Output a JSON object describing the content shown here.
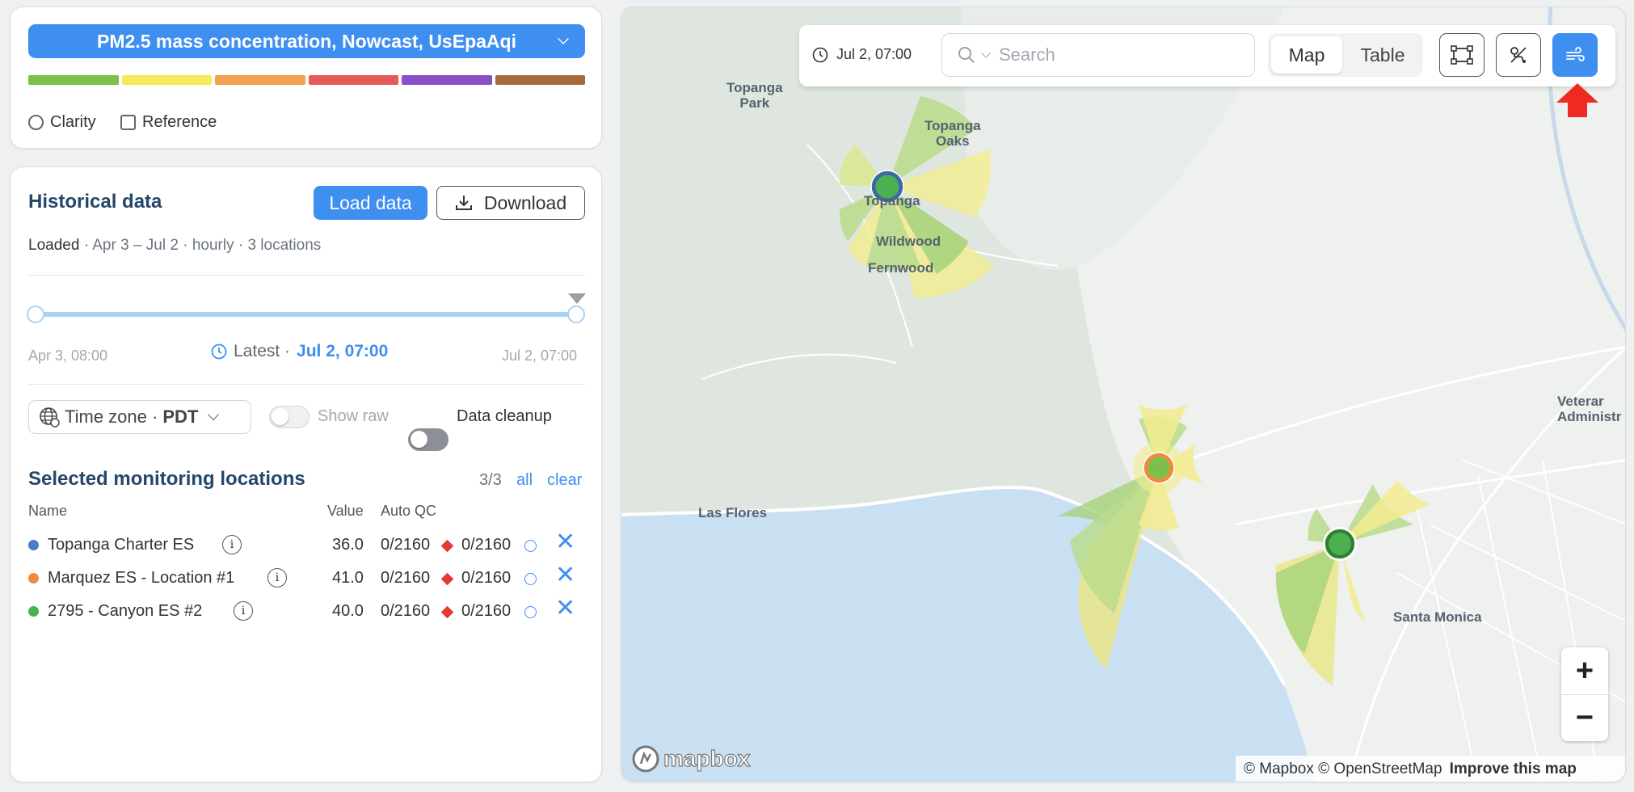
{
  "pollutant": {
    "label": "PM2.5 mass concentration, Nowcast, UsEpaAqi"
  },
  "aqi_colors": [
    "#7cc04c",
    "#f6e85a",
    "#f0a44c",
    "#e85a55",
    "#8a4fc7",
    "#a86b40"
  ],
  "sources": {
    "clarity": "Clarity",
    "reference": "Reference"
  },
  "historical": {
    "title": "Historical data",
    "load_label": "Load data",
    "download_label": "Download",
    "status": "Loaded",
    "range": "Apr 3 – Jul 2",
    "interval": "hourly",
    "locations_count": "3 locations",
    "slider_start": "Apr 3, 08:00",
    "slider_end": "Jul 2, 07:00",
    "latest_label": "Latest ·",
    "latest_value": "Jul 2, 07:00"
  },
  "controls": {
    "timezone_label": "Time zone ·",
    "timezone_value": "PDT",
    "show_raw": "Show raw",
    "data_cleanup": "Data cleanup"
  },
  "selected": {
    "title": "Selected monitoring locations",
    "count": "3/3",
    "all": "all",
    "clear": "clear",
    "columns": {
      "name": "Name",
      "value": "Value",
      "auto_qc": "Auto QC"
    },
    "rows": [
      {
        "name": "Topanga Charter ES",
        "color": "#4a7fc1",
        "value": "36.0",
        "qc1": "0/2160",
        "qc2": "0/2160"
      },
      {
        "name": "Marquez ES - Location #1",
        "color": "#f08a3c",
        "value": "41.0",
        "qc1": "0/2160",
        "qc2": "0/2160"
      },
      {
        "name": "2795 - Canyon ES #2",
        "color": "#4caf50",
        "value": "40.0",
        "qc1": "0/2160",
        "qc2": "0/2160"
      }
    ]
  },
  "map": {
    "time": "Jul 2, 07:00",
    "search_placeholder": "Search",
    "view_map": "Map",
    "view_table": "Table",
    "labels": {
      "topanga_park": "Topanga\nPark",
      "topanga_oaks": "Topanga\nOaks",
      "topanga": "Topanga",
      "wildwood": "Wildwood",
      "fernwood": "Fernwood",
      "las_flores": "Las Flores",
      "santa_monica": "Santa Monica",
      "veterans": "Veterar\nAdministr"
    },
    "zoom_in": "+",
    "zoom_out": "−",
    "logo": "mapbox",
    "attribution": "© Mapbox © OpenStreetMap",
    "improve": "Improve this map"
  }
}
